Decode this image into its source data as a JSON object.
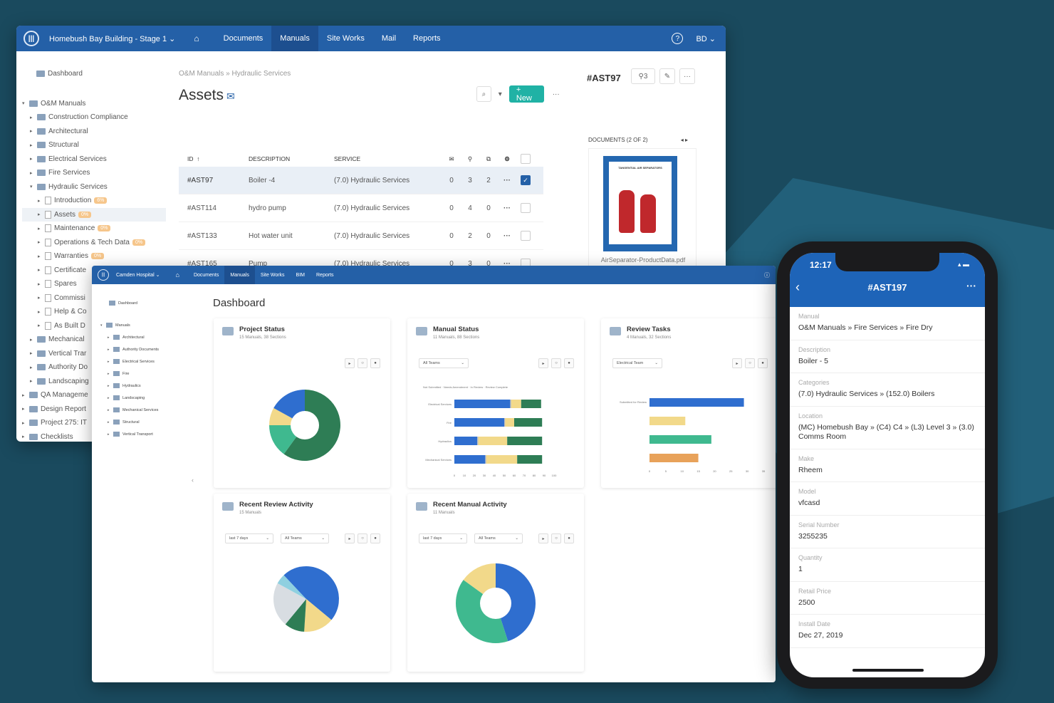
{
  "winA": {
    "project": "Homebush Bay Building - Stage 1",
    "nav": [
      "Documents",
      "Manuals",
      "Site Works",
      "Mail",
      "Reports"
    ],
    "user": "BD",
    "tree": [
      {
        "label": "Dashboard",
        "badge": ""
      },
      {
        "label": "O&M Manuals",
        "badge": ""
      },
      {
        "label": "Construction Compliance",
        "badge": ""
      },
      {
        "label": "Architectural",
        "badge": ""
      },
      {
        "label": "Structural",
        "badge": ""
      },
      {
        "label": "Electrical Services",
        "badge": ""
      },
      {
        "label": "Fire Services",
        "badge": ""
      },
      {
        "label": "Hydraulic Services",
        "badge": ""
      },
      {
        "label": "Introduction",
        "badge": "6%"
      },
      {
        "label": "Assets",
        "badge": "0%"
      },
      {
        "label": "Maintenance",
        "badge": "0%"
      },
      {
        "label": "Operations & Tech Data",
        "badge": "0%"
      },
      {
        "label": "Warranties",
        "badge": "0%"
      },
      {
        "label": "Certificate",
        "badge": ""
      },
      {
        "label": "Spares",
        "badge": ""
      },
      {
        "label": "Commissi",
        "badge": ""
      },
      {
        "label": "Help & Co",
        "badge": ""
      },
      {
        "label": "As Built D",
        "badge": ""
      },
      {
        "label": "Mechanical",
        "badge": ""
      },
      {
        "label": "Vertical Trar",
        "badge": ""
      },
      {
        "label": "Authority Do",
        "badge": ""
      },
      {
        "label": "Landscaping",
        "badge": ""
      },
      {
        "label": "QA Manageme",
        "badge": ""
      },
      {
        "label": "Design Report",
        "badge": ""
      },
      {
        "label": "Project 275: IT",
        "badge": ""
      },
      {
        "label": "Checklists",
        "badge": ""
      }
    ],
    "breadcrumb": "O&M Manuals » Hydraulic Services",
    "title": "Assets",
    "new_label": "+ New",
    "columns": {
      "id": "ID",
      "desc": "DESCRIPTION",
      "svc": "SERVICE"
    },
    "rows": [
      {
        "id": "#AST97",
        "desc": "Boiler -4",
        "svc": "(7.0) Hydraulic Services",
        "a": "0",
        "b": "3",
        "c": "2"
      },
      {
        "id": "#AST114",
        "desc": "hydro pump",
        "svc": "(7.0) Hydraulic Services",
        "a": "0",
        "b": "4",
        "c": "0"
      },
      {
        "id": "#AST133",
        "desc": "Hot water unit",
        "svc": "(7.0) Hydraulic Services",
        "a": "0",
        "b": "2",
        "c": "0"
      },
      {
        "id": "#AST165",
        "desc": "Pump",
        "svc": "(7.0) Hydraulic Services",
        "a": "0",
        "b": "3",
        "c": "0"
      }
    ],
    "panel": {
      "asset_id": "#AST97",
      "link_count": "3",
      "docs_label": "DOCUMENTS (2 OF 2)",
      "doc_cover_title": "TANGENTIAL AIR SEPARATORS",
      "doc_name": "AirSeparator-ProductData.pdf"
    }
  },
  "winB": {
    "project": "Camden Hospital",
    "nav": [
      "Documents",
      "Manuals",
      "Site Works",
      "BIM",
      "Reports"
    ],
    "tree": [
      "Dashboard",
      "Manuals",
      "Architectural",
      "Authority Documents",
      "Electrical Services",
      "Fire",
      "Hydraulics",
      "Landscaping",
      "Mechanical Services",
      "Structural",
      "Vertical Transport"
    ],
    "title": "Dashboard",
    "cards": [
      {
        "title": "Project Status",
        "sub": "15 Manuals, 38 Sections"
      },
      {
        "title": "Manual Status",
        "sub": "11 Manuals, 88 Sections",
        "filter": "All Teams"
      },
      {
        "title": "Review Tasks",
        "sub": "4 Manuals, 32 Sections",
        "filter": "Electrical Team"
      },
      {
        "title": "Recent Review Activity",
        "sub": "15 Manuals",
        "filter1": "last 7 days",
        "filter2": "All Teams"
      },
      {
        "title": "Recent Manual Activity",
        "sub": "11 Manuals",
        "filter1": "last 7 days",
        "filter2": "All Teams"
      }
    ],
    "legend": [
      "Not Submitted",
      "Needs Amendment",
      "In Review",
      "Review Complete"
    ],
    "colors": {
      "blue": "#2f6ecf",
      "darkgreen": "#2e7d55",
      "green": "#3fb98f",
      "yellow": "#f2d98a",
      "orange": "#e8a25a"
    }
  },
  "phone": {
    "time": "12:17",
    "title": "#AST197",
    "fields": [
      {
        "label": "Manual",
        "value": "O&M Manuals » Fire Services » Fire Dry"
      },
      {
        "label": "Description",
        "value": "Boiler - 5"
      },
      {
        "label": "Categories",
        "value": "(7.0) Hydraulic Services » (152.0) Boilers"
      },
      {
        "label": "Location",
        "value": "(MC) Homebush Bay » (C4) C4 » (L3) Level 3 » (3.0) Comms Room"
      },
      {
        "label": "Make",
        "value": "Rheem"
      },
      {
        "label": "Model",
        "value": "vfcasd"
      },
      {
        "label": "Serial Number",
        "value": "3255235"
      },
      {
        "label": "Quantity",
        "value": "1"
      },
      {
        "label": "Retail Price",
        "value": "2500"
      },
      {
        "label": "Install Date",
        "value": "Dec 27, 2019"
      }
    ]
  },
  "chart_data": [
    {
      "type": "pie",
      "title": "Project Status",
      "series": [
        {
          "values": [
            60,
            15,
            8,
            17
          ]
        }
      ]
    },
    {
      "type": "bar",
      "title": "Manual Status",
      "categories": [
        "Electrical Services",
        "Fire",
        "Hydraulics",
        "Mechanical Services"
      ],
      "xlim": [
        0,
        100
      ],
      "series": [
        {
          "name": "Not Submitted",
          "values": [
            56,
            50,
            23,
            31
          ]
        },
        {
          "name": "Needs Amendment",
          "values": [
            1,
            1,
            1,
            1
          ]
        },
        {
          "name": "In Review",
          "values": [
            10,
            9,
            29,
            31
          ]
        },
        {
          "name": "Review Complete",
          "values": [
            20,
            28,
            35,
            25
          ]
        }
      ]
    },
    {
      "type": "bar",
      "title": "Review Tasks",
      "categories": [
        "Submitted for Review",
        "",
        "",
        ""
      ],
      "xlim": [
        0,
        35
      ],
      "values": [
        29,
        11,
        19,
        15
      ]
    },
    {
      "type": "pie",
      "title": "Recent Review Activity",
      "series": [
        {
          "values": [
            36,
            15,
            10,
            22,
            5,
            12
          ]
        }
      ]
    },
    {
      "type": "pie",
      "title": "Recent Manual Activity",
      "series": [
        {
          "values": [
            45,
            40,
            15
          ]
        }
      ]
    }
  ]
}
